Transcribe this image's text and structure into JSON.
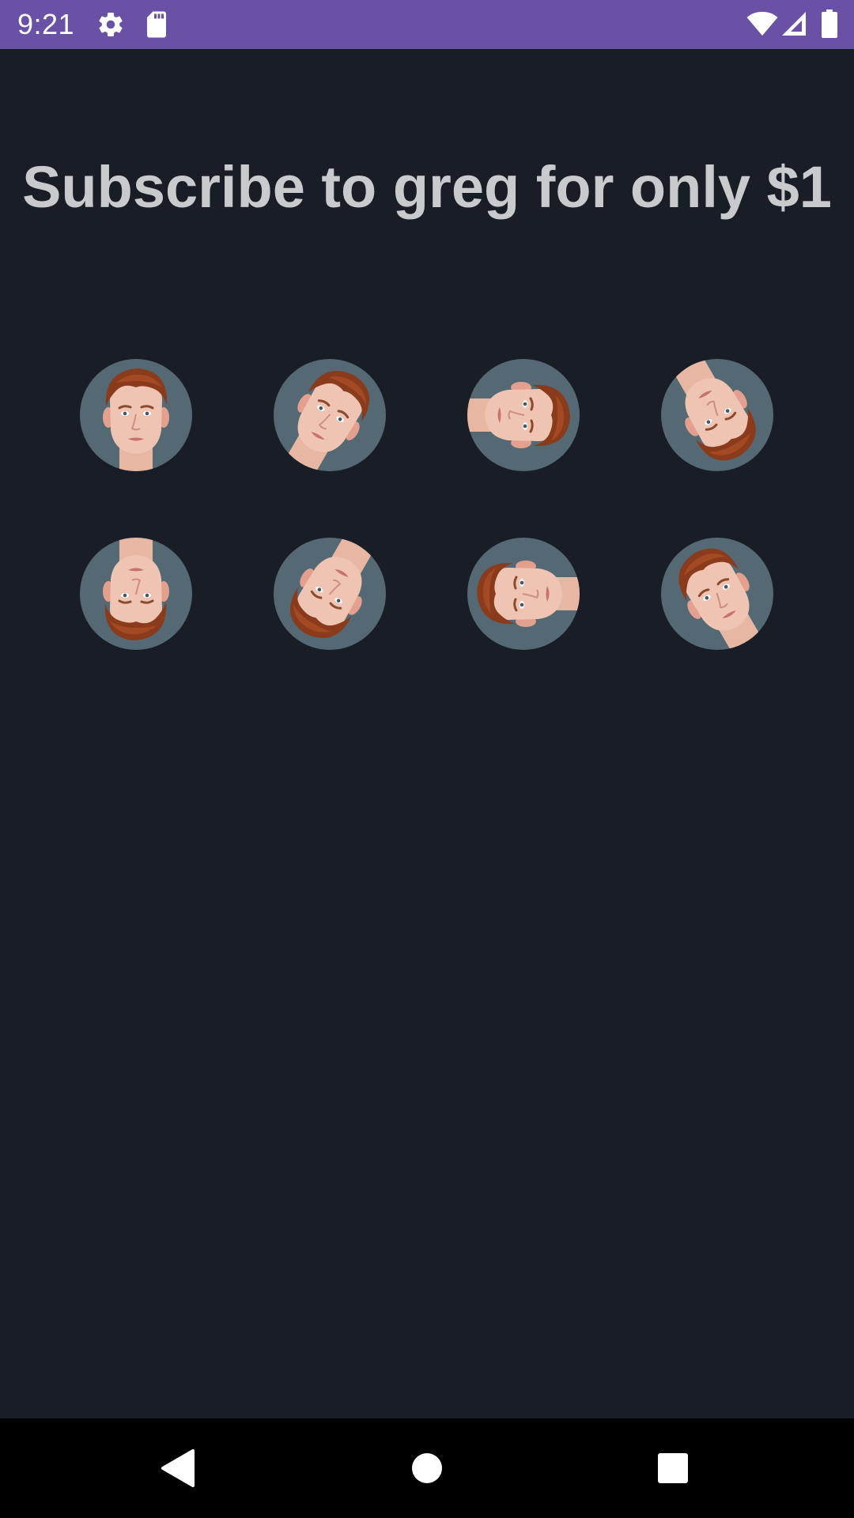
{
  "status_bar": {
    "time": "9:21",
    "background": "#6951a5",
    "icons": [
      "gear-icon",
      "sd-card-icon",
      "wifi-icon",
      "cellular-signal-icon",
      "battery-icon"
    ]
  },
  "headline": "Subscribe to greg for only $1",
  "colors": {
    "background": "#181d26",
    "headline": "#c9cacc",
    "avatar_circle": "#546973",
    "nav_bar": "#000000"
  },
  "avatar_grid": {
    "rows": 2,
    "columns": 4,
    "rotations_deg": [
      0,
      30,
      90,
      150,
      180,
      210,
      270,
      330
    ]
  },
  "nav_bar": {
    "icons": [
      "back-icon",
      "home-icon",
      "recents-icon"
    ]
  }
}
